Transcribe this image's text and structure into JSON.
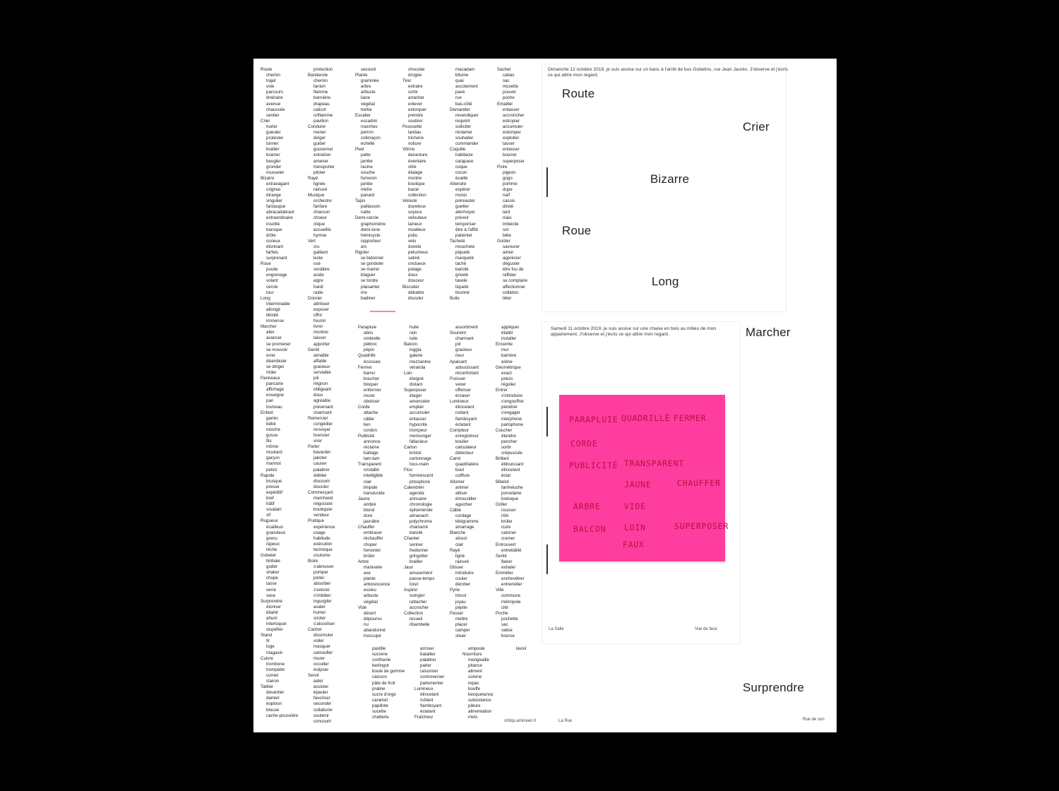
{
  "columns_top": [
    [
      "Route",
      "chemin",
      "trajet",
      "voie",
      "parcours",
      "itinéraire",
      "avenue",
      "chaussée",
      "sentier",
      "Crier",
      "hurler",
      "gueuler",
      "protester",
      "tonner",
      "brailler",
      "bramer",
      "beugler",
      "gronder",
      "rousseler",
      "Bizarre",
      "extravagant",
      "original",
      "étrange",
      "singulier",
      "fantasque",
      "abracadabrant",
      "extraordinaire",
      "insolite",
      "baroque",
      "drôle",
      "curieux",
      "étonnant",
      "farfelu",
      "surprenant",
      "Roue",
      "poulie",
      "engrenage",
      "volant",
      "cercle",
      "tour",
      "Long",
      "interminable",
      "allongé",
      "illimité",
      "immense",
      "Marcher",
      "aller",
      "avancer",
      "se promener",
      "se mouvoir",
      "errer",
      "déambuler",
      "se diriger",
      "rôder",
      "Panneaux",
      "pancarte",
      "affichage",
      "enseigne",
      "pan",
      "trumeau",
      "Enfant",
      "gamin",
      "bébé",
      "mioche",
      "gosse",
      "fils",
      "môme",
      "moutard",
      "garçon",
      "marmot",
      "petiot",
      "Rapide",
      "brusque",
      "pressé",
      "expéditif",
      "bref",
      "hâtif",
      "soudain",
      "vif",
      "Rugueux",
      "écailleux",
      "granuleux",
      "grenu",
      "râpeux",
      "rêche",
      "Gobelet",
      "timbale",
      "godet",
      "shaker",
      "chope",
      "tasse",
      "verre",
      "vase",
      "Surprendre",
      "étonner",
      "ébahir",
      "ahurir",
      "interloquer",
      "stupéfier",
      "Stand",
      "tir",
      "loge",
      "magasin",
      "Cuivre",
      "trombone",
      "trompette",
      "cornet",
      "clairon",
      "Tablier",
      "devantier",
      "damier",
      "éoploon",
      "blouse",
      "cache-poussière"
    ],
    [
      "protection",
      "Banderole",
      "chemin",
      "fanion",
      "flamme",
      "bannière",
      "drapeau",
      "calicot",
      "oriflamme",
      "pavillon",
      "Conduire",
      "mener",
      "diriger",
      "guider",
      "gouverner",
      "entraîner",
      "amener",
      "transporter",
      "piloter",
      "Rayé",
      "lignée",
      "rainuré",
      "Musique",
      "orchestre",
      "fanfare",
      "chanson",
      "choeur",
      "clique",
      "accueillis",
      "hymne",
      "Vert",
      "cru",
      "gaillard",
      "leste",
      "osé",
      "verdâtre",
      "acide",
      "aigre",
      "hardi",
      "raide",
      "Donner",
      "attribuer",
      "exposer",
      "offrir",
      "fournir",
      "livrer",
      "montrer",
      "laisser",
      "apporter",
      "Gentil",
      "aimable",
      "affable",
      "gracieux",
      "serviable",
      "joli",
      "mignon",
      "obligeant",
      "doux",
      "agréable",
      "prévenant",
      "charmant",
      "Remercier",
      "congédier",
      "renvoyer",
      "licencier",
      "virer",
      "Parler",
      "bavarder",
      "jaboter",
      "causer",
      "palabrer",
      "débiter",
      "discourir",
      "discuter",
      "Commerçant",
      "marchand",
      "négociant",
      "boutiquier",
      "vendeur",
      "Pratique",
      "expérience",
      "usage",
      "habitude",
      "exécution",
      "technique",
      "coutume",
      "Boire",
      "s'abreuver",
      "pomper",
      "pinter",
      "absorber",
      "s'enivrer",
      "s'imbiber",
      "ingurgiter",
      "avaler",
      "humer",
      "siroter",
      "s'alcooliser",
      "Cacher",
      "dissimuler",
      "voiler",
      "masquer",
      "camoufler",
      "murer",
      "occulter",
      "éclipser",
      "Servir",
      "aider",
      "assister",
      "épauler",
      "favoriser",
      "seconder",
      "collaborer",
      "soutenir",
      "concourir"
    ],
    [
      "secourir",
      "Plante",
      "graminée",
      "arbre",
      "arbuste",
      "liane",
      "végétal",
      "herbe",
      "Escalier",
      "escadrin",
      "marches",
      "perron",
      "colimaçon",
      "échelle",
      "Pied",
      "patte",
      "jambe",
      "racine",
      "souche",
      "fumeron",
      "jambe",
      "mètre",
      "panard",
      "Tapis",
      "paillasson",
      "natte",
      "Demi-cercle",
      "graphomètre",
      "demi-lune",
      "hémicycle",
      "rapporteur",
      "arc",
      "Rigoler",
      "se bidonner",
      "se gondoler",
      "se marrer",
      "blaguer",
      "se tordre",
      "plaisanter",
      "rire",
      "badiner"
    ],
    [
      "chocolat",
      "drogée",
      "Tirer",
      "extraire",
      "sortir",
      "arracher",
      "enlever",
      "extorquer",
      "prendre",
      "soutirer",
      "Poussette",
      "landau",
      "tricherie",
      "voiture",
      "Vitrine",
      "devanture",
      "éventaire",
      "vitre",
      "étalage",
      "montre",
      "boutique",
      "bazar",
      "collection",
      "Velouté",
      "duveteux",
      "soyeux",
      "velouteux",
      "laineux",
      "moelleux",
      "poilu",
      "velu",
      "duveté",
      "pelucheux",
      "satiné",
      "onctueux",
      "potage",
      "doux",
      "douceur",
      "Biscuiter",
      "débattre",
      "discuter"
    ],
    [
      "macadam",
      "bitume",
      "quai",
      "accotement",
      "pavé",
      "rue",
      "bas-côté",
      "Demander",
      "revendiquer",
      "requérir",
      "solliciter",
      "réclamer",
      "souhaiter",
      "commander",
      "Coquille",
      "habitacle",
      "carapace",
      "coque",
      "cocon",
      "écaille",
      "Attendre",
      "espérer",
      "moisir",
      "poireauter",
      "guetter",
      "atermoyer",
      "prévoir",
      "temporiser",
      "être à l'affût",
      "patienter",
      "Tacheté",
      "moucheté",
      "piqueté",
      "marqueté",
      "taché",
      "bariolé",
      "grivelé",
      "tavelé",
      "tiqueté",
      "tisonné",
      "Bulle"
    ],
    [
      "Sachet",
      "cabas",
      "sac",
      "musette",
      "pouvet",
      "poche",
      "Emailler",
      "entasser",
      "accroncher",
      "estropier",
      "accumuler",
      "estomper",
      "exploiter",
      "tasser",
      "entasser",
      "bourrer",
      "superposer",
      "Poire",
      "pigeon",
      "gogo",
      "pomme",
      "dupe",
      "naïf",
      "cassis",
      "dindé",
      "lard",
      "niais",
      "imbécile",
      "sot",
      "bête",
      "Goûter",
      "savourer",
      "aimer",
      "apprécier",
      "déguster",
      "être fou de",
      "raffoler",
      "se complaire",
      "affectionner",
      "collation",
      "téter"
    ]
  ],
  "columns_bottom": [
    [
      "Parapluie",
      "abris",
      "ombrelle",
      "pébroc",
      "pépin",
      "Quadrillé",
      "écossais",
      "Fermer",
      "barrer",
      "boucher",
      "bloquer",
      "enfermer",
      "murer",
      "obstruer",
      "Corde",
      "attache",
      "câble",
      "lien",
      "cordon",
      "Publicité",
      "annonce",
      "réclame",
      "battage",
      "tam-tam",
      "Transparent",
      "cristallin",
      "intelligible",
      "clair",
      "limpide",
      "translucide",
      "Jaune",
      "ambré",
      "blond",
      "doré",
      "jaunâtre",
      "Chauffer",
      "embraser",
      "réchauffer",
      "choper",
      "fomenter",
      "brûler",
      "Arbre",
      "manivelle",
      "axe",
      "plante",
      "arborescence",
      "essieu",
      "arbuste",
      "végétal",
      "Vide",
      "désert",
      "dépourvu",
      "nu",
      "abandonné",
      "inoccupé"
    ],
    [
      "huile",
      "rain",
      "tuile",
      "Balcon",
      "loggia",
      "galerie",
      "mezzanine",
      "véranda",
      "Loin",
      "éloigné",
      "distant",
      "Superposer",
      "étager",
      "amonceler",
      "empiler",
      "accumuler",
      "entasser",
      "hypocrite",
      "trompeur",
      "mensonger",
      "fallacieux",
      "Carton",
      "bristol",
      "cartonnage",
      "tous-main",
      "Flou",
      "fuminescent",
      "phosphore",
      "Calendrier",
      "agenda",
      "annuaire",
      "chronologie",
      "éphéméride",
      "almanach",
      "polychrome",
      "chamarré",
      "bariolé",
      "Chanter",
      "seriner",
      "fredonner",
      "gringotter",
      "brailler",
      "Jaux",
      "amusement",
      "passe-temps",
      "loisir",
      "Aspirer",
      "soingier",
      "rattacher",
      "accrocher",
      "Collection",
      "recueil",
      "ribambelle"
    ],
    [
      "assortiment",
      "Sourient",
      "charmant",
      "joli",
      "gracieux",
      "rieur",
      "Apaisant",
      "adoucissant",
      "réconfortant",
      "Froisser",
      "vexer",
      "offenser",
      "écraser",
      "Lumineux",
      "étincelant",
      "rutilant",
      "flamboyant",
      "éclatant",
      "Compteur",
      "enregistreur",
      "boulier",
      "calculateur",
      "détecteur",
      "Carré",
      "quadrilatère",
      "bout",
      "coiffure",
      "Allumer",
      "animer",
      "attiser",
      "émoustiller",
      "aguicher",
      "Câble",
      "cordage",
      "télégramme",
      "amarrage",
      "Blanche",
      "alcool",
      "clair",
      "Rayé",
      "ligné",
      "rainuré",
      "Glisser",
      "introduire",
      "couler",
      "dérober",
      "Pyrie",
      "trésor",
      "joyau",
      "pépite",
      "Passer",
      "mettre",
      "placer",
      "camper",
      "situer"
    ],
    [
      "appliquer",
      "établir",
      "installer",
      "Enceinte",
      "mur",
      "barrière",
      "arène",
      "Géométrique",
      "exact",
      "précis",
      "régulier",
      "Entrer",
      "s'introduire",
      "s'engouffrer",
      "pénétrer",
      "s'engager",
      "interphone",
      "parlophone",
      "Coucher",
      "étendre",
      "pencher",
      "sortir",
      "crépuscule",
      "Brillant",
      "éblouissant",
      "étincelant",
      "éclat",
      "Bibelot",
      "fanfreluche",
      "porcelaine",
      "breloque",
      "Griller",
      "rousser",
      "rôtir",
      "brûler",
      "cuire",
      "calciner",
      "cramer",
      "Entrouvert",
      "entrebâillé",
      "Sentir",
      "flairer",
      "exhaler",
      "Emmêler",
      "enchevêtrer",
      "entremêler",
      "Ville",
      "commune",
      "métropole",
      "cité",
      "Poche",
      "pochette",
      "sac",
      "valise",
      "bourse"
    ]
  ],
  "columns_tail": [
    [
      "pastille",
      "sucrerie",
      "confiserie",
      "berlingot",
      "boule de gomme",
      "caisson",
      "pâte de fruit",
      "praline",
      "sucre d'orge",
      "caramel",
      "papillote",
      "sucette",
      "chatterie"
    ],
    [
      "arroser",
      "batailler",
      "palabrer",
      "parler",
      "raisonner",
      "controverser",
      "parlementer",
      "Lumineux",
      "étincelant",
      "rutilant",
      "flamboyant",
      "éclatant",
      "Fraîcheur"
    ],
    [
      "ampoule",
      "Nourriture",
      "mangeaille",
      "pitance",
      "aliment",
      "cuisine",
      "repas",
      "bouffe",
      "becquetance",
      "subsistance",
      "pâture",
      "alimentation",
      "mets"
    ],
    [
      "lavoir"
    ]
  ],
  "insert_top_caption": "Dimanche 12 octobre 2019, je suis assise sur un banc à l'arrêt de bus Gobelins, rue Jean Jaurès. J'observe et j'écris ce qui attire mon regard.",
  "insert_bottom_caption": "Samedi 11 octobre 2019, je suis assise sur une chaise en bois au milieu de mon appartement. J'observe et j'écris ce qui attire mon regard.",
  "big_words": {
    "route": "Route",
    "crier": "Crier",
    "bizarre": "Bizarre",
    "roue": "Roue",
    "long": "Long",
    "marcher": "Marcher",
    "surprendre": "Surprendre"
  },
  "postit_words": {
    "w1": "PARAPLUIE",
    "w2": "QUADRILLÉ",
    "w3": "FERMER",
    "w4": "CORDE",
    "w5": "PUBLICITÉ",
    "w6": "TRANSPARENT",
    "w7": "JAUNE",
    "w8": "CHAUFFER",
    "w9": "ARBRE",
    "w10": "VIDE",
    "w11": "BALCON",
    "w12": "LOIN",
    "w13": "SUPERPOSER",
    "w14": "FAUX"
  },
  "footer": {
    "la_salle": "La Salle",
    "vue_de_face": "Vue de face",
    "credit": "critiqu.amiceen.fr",
    "la_rue": "La Rue",
    "rue_de_son": "Rue de son"
  },
  "colors": {
    "postit": "#ff3d9f",
    "handwriting": "#b4123f",
    "paper": "#ffffff",
    "background": "#000000"
  }
}
